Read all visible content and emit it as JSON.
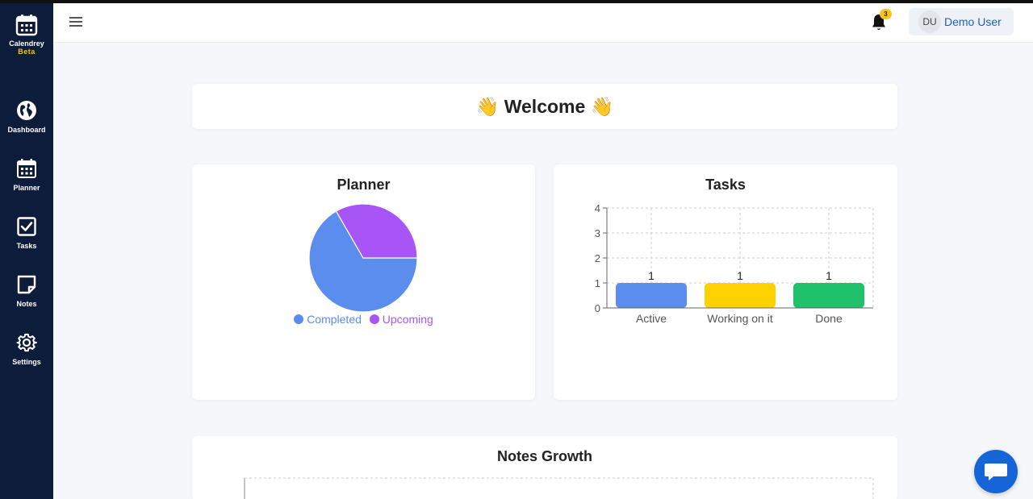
{
  "app": {
    "name": "Calendrey",
    "badge": "Beta",
    "icons": {
      "logo": "calendar-icon"
    }
  },
  "sidebar": {
    "items": [
      {
        "label": "Dashboard",
        "icon": "globe-icon"
      },
      {
        "label": "Planner",
        "icon": "calendar-icon"
      },
      {
        "label": "Tasks",
        "icon": "checkbox-icon"
      },
      {
        "label": "Notes",
        "icon": "note-icon"
      },
      {
        "label": "Settings",
        "icon": "gear-icon"
      }
    ]
  },
  "header": {
    "notification_count": "3",
    "user_initials": "DU",
    "user_name": "Demo User"
  },
  "main": {
    "welcome": "👋 Welcome 👋",
    "planner": {
      "title": "Planner"
    },
    "tasks": {
      "title": "Tasks"
    },
    "notes_growth": {
      "title": "Notes Growth"
    }
  },
  "colors": {
    "sidebar_bg": "#0c1c3a",
    "accent": "#1565d8",
    "badge": "#f5c518",
    "completed": "#5b8def",
    "upcoming": "#a855f7",
    "active": "#5b8def",
    "working": "#fdd200",
    "done": "#1ec26a"
  },
  "chart_data": [
    {
      "type": "pie",
      "title": "Planner",
      "labels": [
        "Completed",
        "Upcoming"
      ],
      "values": [
        2,
        1
      ],
      "colors": [
        "#5b8def",
        "#a855f7"
      ],
      "legend_position": "bottom"
    },
    {
      "type": "bar",
      "title": "Tasks",
      "categories": [
        "Active",
        "Working on it",
        "Done"
      ],
      "values": [
        1,
        1,
        1
      ],
      "data_labels": [
        "1",
        "1",
        "1"
      ],
      "colors": [
        "#5b8def",
        "#fdd200",
        "#1ec26a"
      ],
      "ylim": [
        0,
        4
      ],
      "yticks": [
        "0",
        "1",
        "2",
        "3",
        "4"
      ],
      "grid": true
    }
  ]
}
